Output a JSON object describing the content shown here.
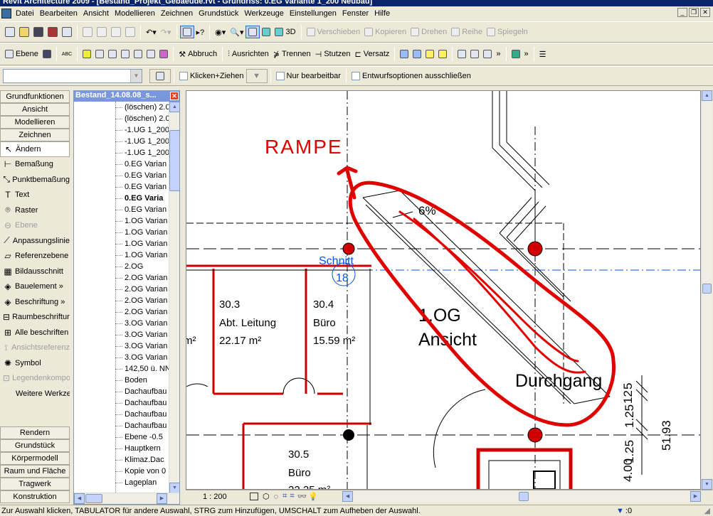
{
  "window": {
    "title": "Revit Architecture 2009 - [Bestand_Projekt_Gebaeude.rvt - Grundriss: 0.EG Variante 1_200 Neubau]"
  },
  "menu": [
    "Datei",
    "Bearbeiten",
    "Ansicht",
    "Modellieren",
    "Zeichnen",
    "Grundstück",
    "Werkzeuge",
    "Einstellungen",
    "Fenster",
    "Hilfe"
  ],
  "toolbar1": {
    "view3d": "3D",
    "verschieben": "Verschieben",
    "kopieren": "Kopieren",
    "drehen": "Drehen",
    "reihe": "Reihe",
    "spiegeln": "Spiegeln"
  },
  "toolbar2": {
    "ebene": "Ebene",
    "abbruch": "Abbruch",
    "ausrichten": "Ausrichten",
    "trennen": "Trennen",
    "stutzen": "Stutzen",
    "versatz": "Versatz"
  },
  "toolbar3": {
    "klicken_ziehen": "Klicken+Ziehen",
    "nur_bearbeitbar": "Nur bearbeitbar",
    "entwurfsoptionen": "Entwurfsoptionen ausschließen"
  },
  "designbar": {
    "tabs_top": [
      "Grundfunktionen",
      "Ansicht",
      "Modellieren",
      "Zeichnen"
    ],
    "items": [
      {
        "label": "Ändern",
        "icon": "arrow-cursor-icon",
        "disabled": false,
        "selected": true
      },
      {
        "label": "Bemaßung",
        "icon": "dimension-icon",
        "disabled": false
      },
      {
        "label": "Punktbemaßung",
        "icon": "spot-dimension-icon",
        "disabled": false
      },
      {
        "label": "Text",
        "icon": "text-icon",
        "disabled": false
      },
      {
        "label": "Raster",
        "icon": "grid-icon",
        "disabled": false
      },
      {
        "label": "Ebene",
        "icon": "level-icon",
        "disabled": true
      },
      {
        "label": "Anpassungslinie",
        "icon": "detail-line-icon",
        "disabled": false
      },
      {
        "label": "Referenzebene",
        "icon": "reference-plane-icon",
        "disabled": false
      },
      {
        "label": "Bildausschnitt",
        "icon": "callout-icon",
        "disabled": false
      },
      {
        "label": "Bauelement »",
        "icon": "component-icon",
        "disabled": false
      },
      {
        "label": "Beschriftung »",
        "icon": "tag-icon",
        "disabled": false
      },
      {
        "label": "Raumbeschriftung",
        "icon": "room-tag-icon",
        "disabled": false
      },
      {
        "label": "Alle beschriften",
        "icon": "tag-all-icon",
        "disabled": false
      },
      {
        "label": "Ansichtsreferenz",
        "icon": "view-reference-icon",
        "disabled": true
      },
      {
        "label": "Symbol",
        "icon": "symbol-icon",
        "disabled": false
      },
      {
        "label": "Legendenkomponente",
        "icon": "legend-icon",
        "disabled": true
      },
      {
        "label": "Weitere Werkzeuge",
        "icon": "",
        "disabled": false
      }
    ],
    "tabs_bottom": [
      "Rendern",
      "Grundstück",
      "Körpermodell",
      "Raum und Fläche",
      "Tragwerk",
      "Konstruktion"
    ]
  },
  "browser": {
    "title": "Bestand_14.08.08_s...",
    "items": [
      "(löschen) 2.0",
      "(löschen) 2.0",
      "-1.UG 1_200",
      "-1.UG 1_200",
      "-1.UG 1_200",
      "0.EG Varian",
      "0.EG Varian",
      "0.EG Varian",
      "0.EG Varia",
      "0.EG Varian",
      "1.OG Varian",
      "1.OG Varian",
      "1.OG Varian",
      "1.OG Varian",
      "2.OG",
      "2.OG Varian",
      "2.OG Varian",
      "2.OG Varian",
      "2.OG Varian",
      "3.OG Varian",
      "3.OG Varian",
      "3.OG Varian",
      "3.OG Varian",
      "142,50 ü. NN",
      "Boden",
      "Dachaufbau",
      "Dachaufbau",
      "Dachaufbau",
      "Dachaufbau",
      "Ebene -0.5",
      "Hauptkern",
      "Klimaz.Dac",
      "Kopie von 0",
      "Lageplan"
    ],
    "bold_index": 8
  },
  "drawing": {
    "annotation": "RAMPE",
    "slope": "6%",
    "section_label": "Schnitt",
    "section_number": "18",
    "rooms": [
      {
        "number": "30.3",
        "name": "Abt. Leitung",
        "area": "22.17 m²"
      },
      {
        "number": "30.4",
        "name": "Büro",
        "area": "15.59 m²"
      },
      {
        "number": "30.5",
        "name": "Büro",
        "area": "22.25 m²"
      }
    ],
    "partial_area": "m²",
    "elevation_label_1": "1.OG",
    "elevation_label_2": "Ansicht",
    "passage": "Durchgang",
    "dims": [
      "5",
      "12",
      "1.25",
      "1.25",
      "51.93",
      "4.00"
    ],
    "annotation_color": "#e00000"
  },
  "viewbar": {
    "scale": "1 : 200"
  },
  "status": {
    "text": "Zur Auswahl klicken, TABULATOR für andere Auswahl, STRG zum Hinzufügen, UMSCHALT zum Aufheben der Auswahl.",
    "filter_count": ":0"
  }
}
